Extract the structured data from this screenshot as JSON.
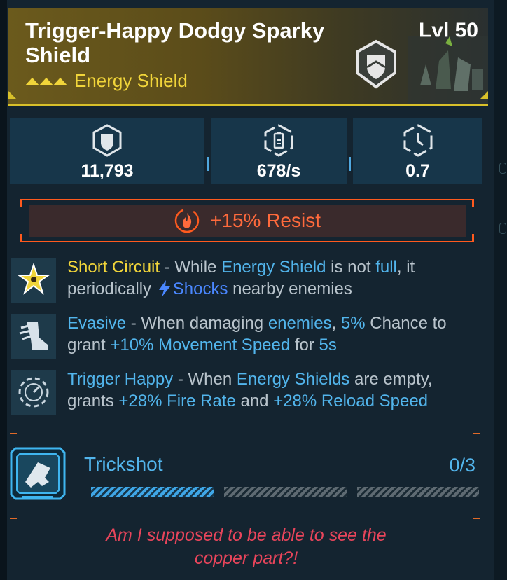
{
  "item": {
    "name": "Trigger-Happy Dodgy Sparky Shield",
    "level": "Lvl 50",
    "rarity_label": "Energy Shield",
    "rarity_color": "#f1d53a",
    "header_icon": "shield-icon"
  },
  "stats": [
    {
      "icon": "shield-capacity-icon",
      "value": "11,793"
    },
    {
      "icon": "battery-recharge-icon",
      "value": "678/s"
    },
    {
      "icon": "recharge-delay-icon",
      "value": "0.7"
    }
  ],
  "resist": {
    "icon": "fire-icon",
    "label": "+15% Resist",
    "color": "#ff6a3c"
  },
  "perks": [
    {
      "icon": "star-burst-icon",
      "name": "Short Circuit",
      "parts": [
        " - While ",
        "Energy Shield",
        " is not ",
        "full",
        ", it periodically ",
        "Shocks",
        " nearby enemies"
      ]
    },
    {
      "icon": "winged-boot-icon",
      "name": "Evasive",
      "parts": [
        " - When damaging ",
        "enemies",
        ", ",
        "5%",
        " Chance to grant ",
        "+10% Movement Speed",
        " for ",
        "5s"
      ]
    },
    {
      "icon": "trigger-gauge-icon",
      "name": "Trigger Happy",
      "parts": [
        " - When ",
        "Energy Shields",
        " are empty, grants ",
        "+28% Fire Rate",
        " and ",
        "+28% Reload Speed"
      ]
    }
  ],
  "skill": {
    "icon": "trickshot-icon",
    "name": "Trickshot",
    "count": "0/3",
    "progress": {
      "filled": 1,
      "total": 3
    }
  },
  "flavor_text": "Am I supposed to be able to see the copper part?!",
  "colors": {
    "accent_blue": "#52b5ec",
    "accent_gold": "#f1d53a",
    "flavor_red": "#e8455b",
    "element_orange": "#ff5a1e"
  }
}
